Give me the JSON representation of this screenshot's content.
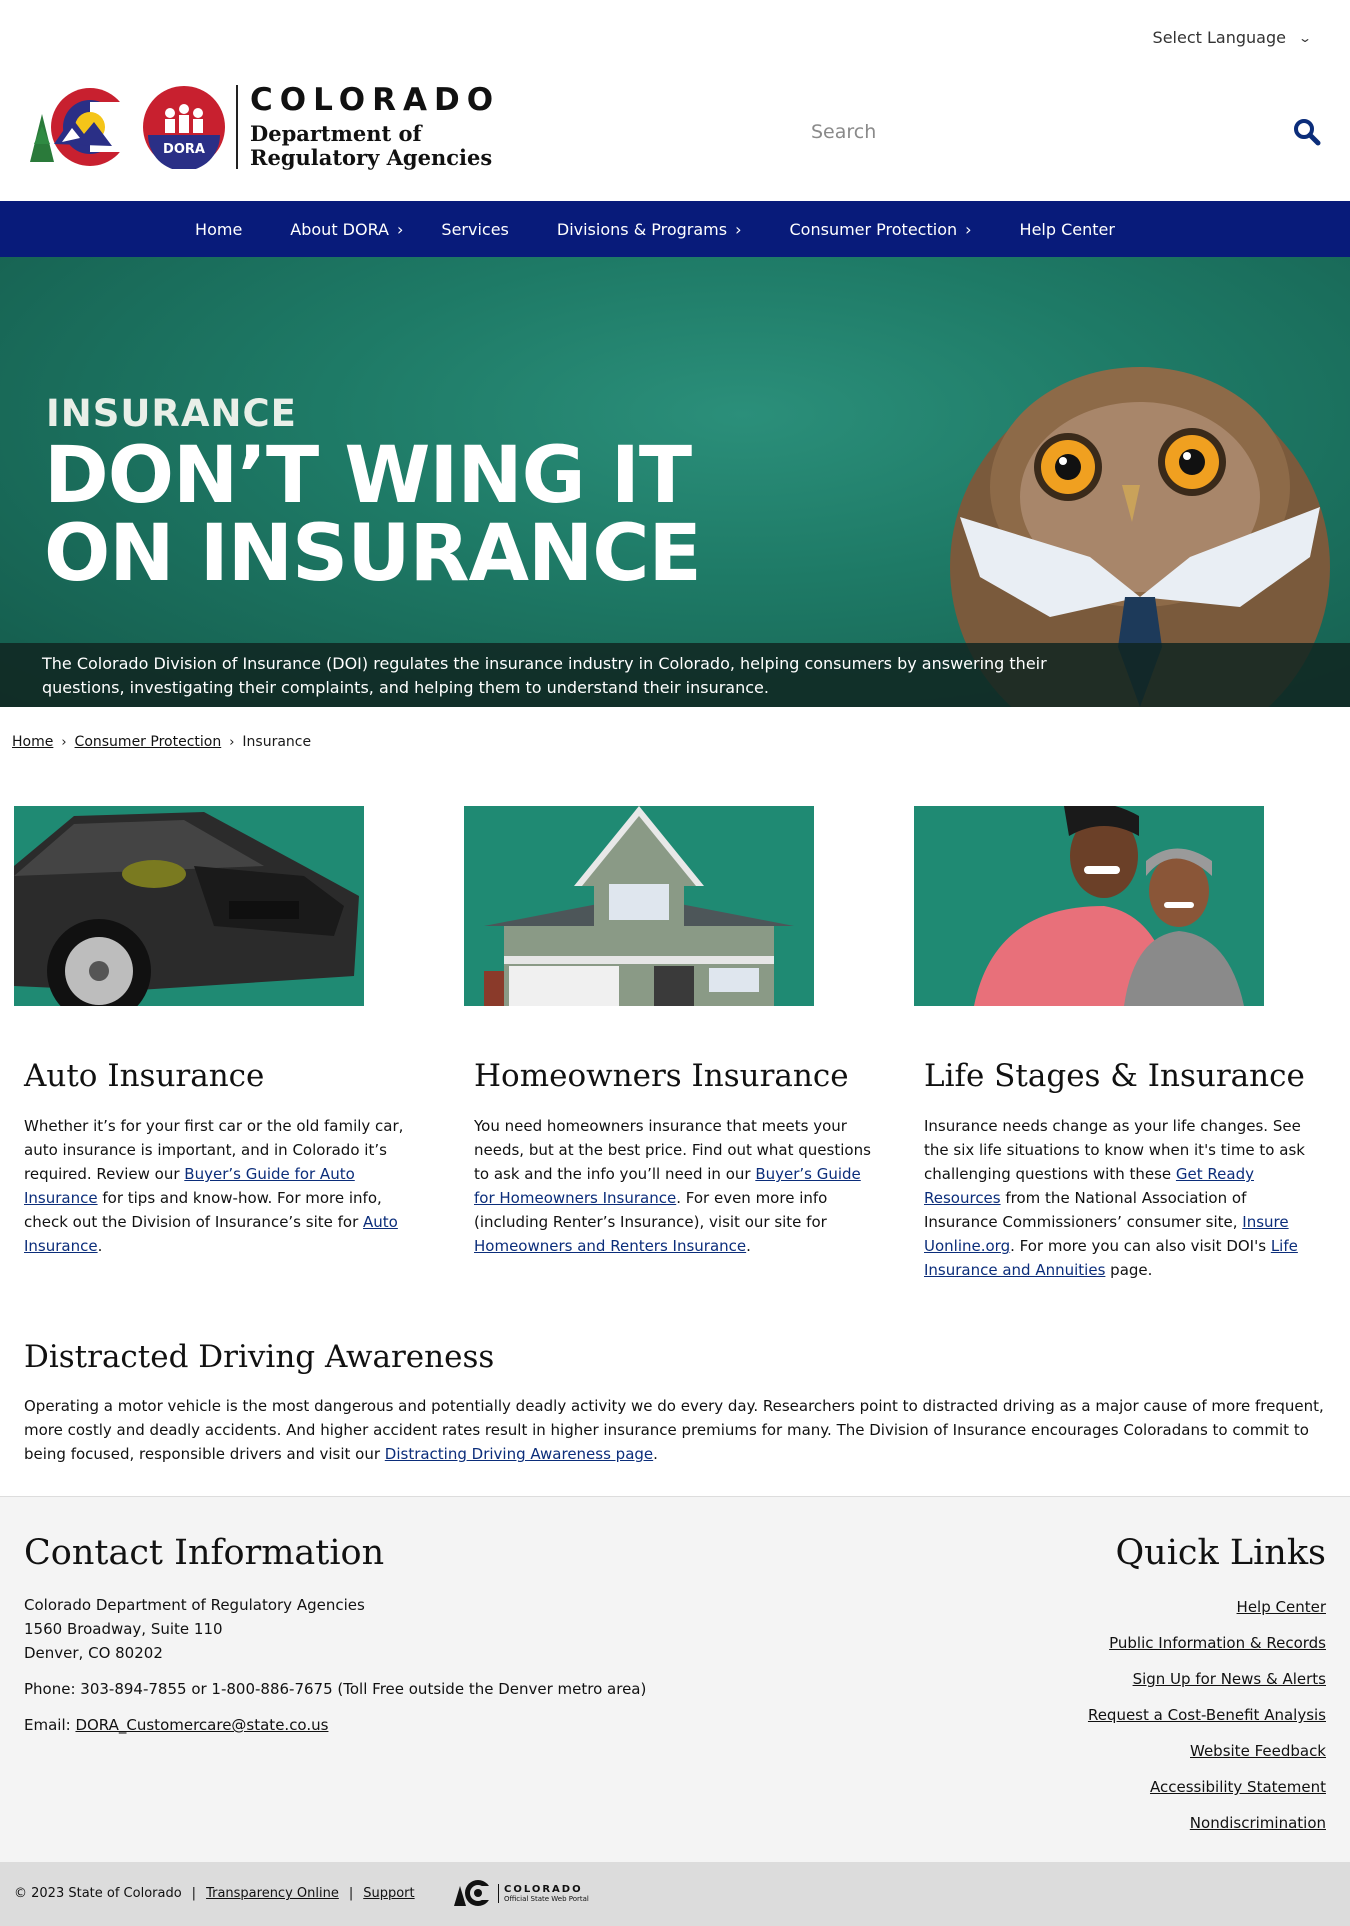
{
  "header": {
    "language_label": "Select Language",
    "logo_title": "COLORADO",
    "logo_subtitle_1": "Department of",
    "logo_subtitle_2": "Regulatory Agencies",
    "dora_badge": "DORA",
    "search_placeholder": "Search"
  },
  "nav": {
    "items": [
      {
        "label": "Home",
        "has_sub": false
      },
      {
        "label": "About DORA",
        "has_sub": true
      },
      {
        "label": "Services",
        "has_sub": false
      },
      {
        "label": "Divisions & Programs",
        "has_sub": true
      },
      {
        "label": "Consumer Protection",
        "has_sub": true
      },
      {
        "label": "Help Center",
        "has_sub": false
      }
    ],
    "chevron": "›"
  },
  "hero": {
    "kicker": "INSURANCE",
    "headline_1": "DON’T WING IT",
    "headline_2": "ON INSURANCE",
    "caption": "The Colorado Division of Insurance (DOI) regulates the insurance industry in Colorado, helping consumers by answering their questions, investigating their complaints, and helping them to understand their insurance."
  },
  "breadcrumb": {
    "home": "Home",
    "consumer": "Consumer Protection",
    "current": "Insurance",
    "sep": "›"
  },
  "cards": {
    "auto": {
      "title": "Auto Insurance",
      "t1": "Whether it’s for your first car or the old family car, auto insurance is important, and in Colorado it’s required.  Review our ",
      "l1": "Buyer’s Guide for Auto Insurance",
      "t2": " for tips and know-how. For more info, check out the Division of Insurance’s site for ",
      "l2": "Auto Insurance",
      "t3": "."
    },
    "home": {
      "title": "Homeowners Insurance",
      "t1": "You need homeowners insurance that meets your needs, but at the best price.  Find out what questions to ask and the info you’ll need in our ",
      "l1": "Buyer’s Guide for Homeowners Insurance",
      "t2": ".  For even more info (including Renter’s Insurance), visit our site for ",
      "l2": "Homeowners and Renters Insurance",
      "t3": "."
    },
    "life": {
      "title": "Life Stages & Insurance",
      "t1": "Insurance needs change as your life changes.  See the six life situations to know when it's time to ask challenging questions with these ",
      "l1": "Get Ready Resources",
      "t2": " from the National Association of Insurance Commissioners’ consumer site, ",
      "l2": "Insure Uonline.org",
      "t3": ". For more you can also visit DOI's ",
      "l3": "Life Insurance and Annuities",
      "t4": " page."
    }
  },
  "distracted": {
    "title": "Distracted Driving Awareness",
    "body": "Operating a motor vehicle is the most dangerous and potentially deadly activity we do every day. Researchers point to distracted driving as a major cause of more frequent, more costly and deadly accidents. And higher accident rates result in higher insurance premiums for many. The Division of Insurance encourages Coloradans to commit to being focused, responsible drivers and visit our ",
    "link": "Distracting Driving Awareness page",
    "end": "."
  },
  "footer": {
    "contact_title": "Contact Information",
    "addr_1": "Colorado Department of Regulatory Agencies",
    "addr_2": "1560 Broadway, Suite 110",
    "addr_3": "Denver, CO 80202",
    "phone": "Phone: 303-894-7855 or 1-800-886-7675 (Toll Free outside the Denver metro area)",
    "email_label": "Email: ",
    "email": "DORA_Customercare@state.co.us",
    "quick_title": "Quick Links",
    "quick_links": [
      "Help Center",
      "Public Information & Records",
      "Sign Up for News & Alerts",
      "Request a Cost-Benefit Analysis",
      "Website Feedback",
      "Accessibility Statement",
      "Nondiscrimination"
    ]
  },
  "bottom": {
    "copyright": "© 2023 State of Colorado",
    "sep": "|",
    "transparency": "Transparency Online",
    "support": "Support",
    "portal_title": "COLORADO",
    "portal_sub": "Official State Web Portal"
  },
  "colors": {
    "nav_bg": "#081b7a",
    "link": "#0b2d7a",
    "hero_green": "#1e7a66",
    "logo_red": "#c8202f",
    "logo_blue": "#2a2f86",
    "logo_gold": "#f5c518"
  },
  "icons": [
    "chevron-down-icon",
    "search-icon",
    "colorado-c-logo",
    "dora-logo",
    "colorado-portal-logo"
  ]
}
